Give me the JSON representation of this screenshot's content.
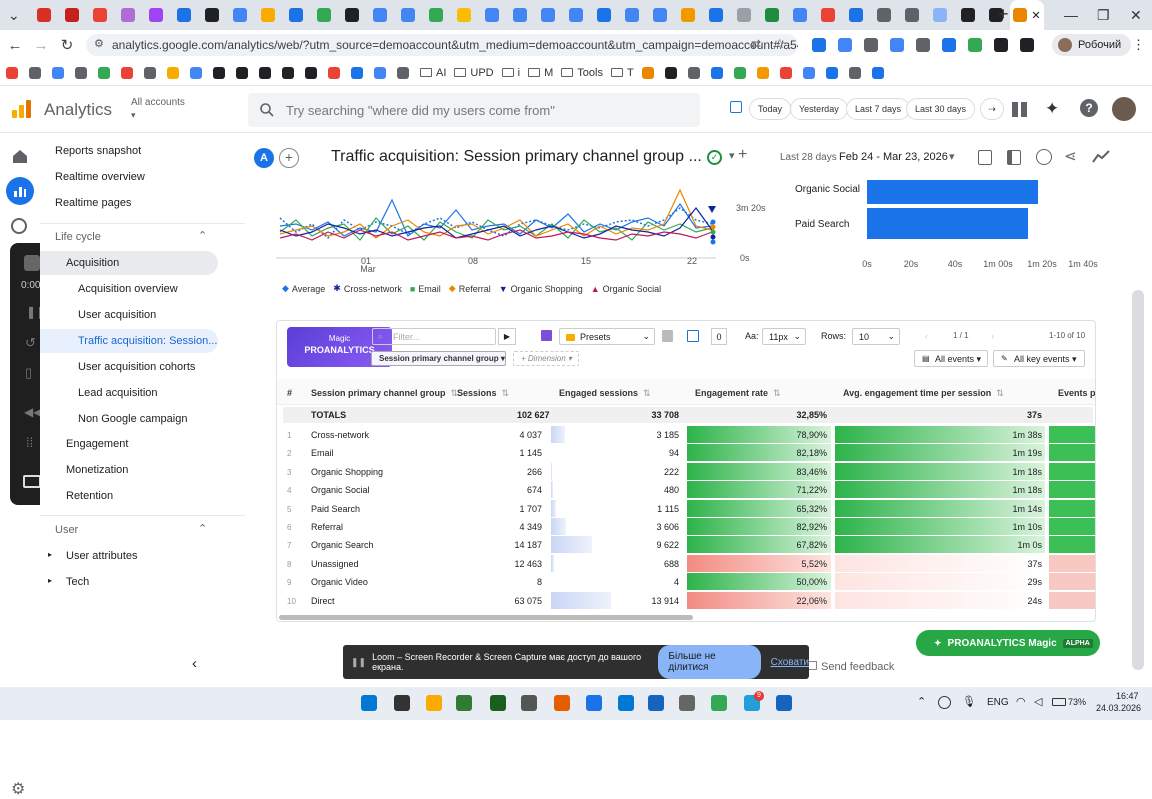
{
  "browser": {
    "url": "analytics.google.com/analytics/web/?utm_source=demoaccount&utm_medium=demoaccount&utm_campaign=demoaccount#/a54516992...",
    "profile": "Робочий",
    "bookmarks": [
      "AI",
      "UPD",
      "i",
      "M",
      "Tools",
      "T"
    ]
  },
  "ga": {
    "title": "Analytics",
    "account": "All accounts",
    "search_placeholder": "Try searching \"where did my users come from\"",
    "date_buttons": [
      "Today",
      "Yesterday",
      "Last 7 days",
      "Last 30 days"
    ],
    "avatar_letter": "A"
  },
  "sidenav": {
    "top": [
      "Reports snapshot",
      "Realtime overview",
      "Realtime pages"
    ],
    "lifecycle": "Life cycle",
    "acquisition": "Acquisition",
    "acq_items": [
      "Acquisition overview",
      "User acquisition",
      "Traffic acquisition: Session...",
      "User acquisition cohorts",
      "Lead acquisition",
      "Non Google campaign"
    ],
    "groups": [
      "Engagement",
      "Monetization",
      "Retention"
    ],
    "user": "User",
    "user_items": [
      "User attributes",
      "Tech"
    ],
    "recorder_time": "0:00"
  },
  "report": {
    "title": "Traffic acquisition: Session primary channel group ...",
    "range_label": "Last 28 days",
    "range": "Feb 24 - Mar 23, 2026"
  },
  "line_chart": {
    "x_ticks": [
      "01",
      "08",
      "15",
      "22"
    ],
    "x_month": "Mar",
    "y_ticks": [
      "3m 20s",
      "0s"
    ],
    "legend": [
      "Average",
      "Cross-network",
      "Email",
      "Referral",
      "Organic Shopping",
      "Organic Social"
    ]
  },
  "bar_chart": {
    "categories": [
      "Organic Social",
      "Paid Search"
    ],
    "x_ticks": [
      "0s",
      "20s",
      "40s",
      "1m 00s",
      "1m 20s",
      "1m 40s"
    ]
  },
  "toolbar": {
    "brand_top": "Magic",
    "brand": "PROANALYTICS",
    "filter_placeholder": "Filter...",
    "presets": "Presets",
    "font_label": "Aa:",
    "font_size": "11px",
    "rows_label": "Rows:",
    "rows_value": "10",
    "page": "1 / 1",
    "range": "1-10 of 10",
    "dimension": "Session primary channel group",
    "add_dimension": "+ Dimension",
    "all_events": "All events",
    "all_key_events": "All key events"
  },
  "table": {
    "headers": [
      "#",
      "Session primary channel group",
      "Sessions",
      "Engaged sessions",
      "Engagement rate",
      "Avg. engagement time per session",
      "Events pe"
    ],
    "totals": {
      "label": "TOTALS",
      "sessions": "102 627",
      "engaged": "33 708",
      "rate": "32,85%",
      "time": "37s"
    },
    "rows": [
      {
        "n": "1",
        "ch": "Cross-network",
        "s": "4 037",
        "e": "3 185",
        "r": "78,90%",
        "t": "1m 38s",
        "rv": 0.789,
        "tv": 98
      },
      {
        "n": "2",
        "ch": "Email",
        "s": "1 145",
        "e": "94",
        "r": "82,18%",
        "t": "1m 19s",
        "rv": 0.8218,
        "tv": 79
      },
      {
        "n": "3",
        "ch": "Organic Shopping",
        "s": "266",
        "e": "222",
        "r": "83,46%",
        "t": "1m 18s",
        "rv": 0.8346,
        "tv": 78
      },
      {
        "n": "4",
        "ch": "Organic Social",
        "s": "674",
        "e": "480",
        "r": "71,22%",
        "t": "1m 18s",
        "rv": 0.7122,
        "tv": 78
      },
      {
        "n": "5",
        "ch": "Paid Search",
        "s": "1 707",
        "e": "1 115",
        "r": "65,32%",
        "t": "1m 14s",
        "rv": 0.6532,
        "tv": 74
      },
      {
        "n": "6",
        "ch": "Referral",
        "s": "4 349",
        "e": "3 606",
        "r": "82,92%",
        "t": "1m 10s",
        "rv": 0.8292,
        "tv": 70
      },
      {
        "n": "7",
        "ch": "Organic Search",
        "s": "14 187",
        "e": "9 622",
        "r": "67,82%",
        "t": "1m 0s",
        "rv": 0.6782,
        "tv": 60
      },
      {
        "n": "8",
        "ch": "Unassigned",
        "s": "12 463",
        "e": "688",
        "r": "5,52%",
        "t": "37s",
        "rv": 0.0552,
        "tv": 37
      },
      {
        "n": "9",
        "ch": "Organic Video",
        "s": "8",
        "e": "4",
        "r": "50,00%",
        "t": "29s",
        "rv": 0.5,
        "tv": 29
      },
      {
        "n": "10",
        "ch": "Direct",
        "s": "63 075",
        "e": "13 914",
        "r": "22,06%",
        "t": "24s",
        "rv": 0.2206,
        "tv": 24
      }
    ]
  },
  "floating": {
    "label": "PROANALYTICS Magic",
    "badge": "ALPHA",
    "feedback": "Send feedback"
  },
  "loom": {
    "text": "Loom – Screen Recorder & Screen Capture має доступ до вашого екрана.",
    "stop": "Більше не ділитися",
    "hide": "Сховати"
  },
  "taskbar": {
    "lang": "ENG",
    "battery": "73%",
    "time": "16:47",
    "date": "24.03.2026",
    "badge": "9"
  }
}
